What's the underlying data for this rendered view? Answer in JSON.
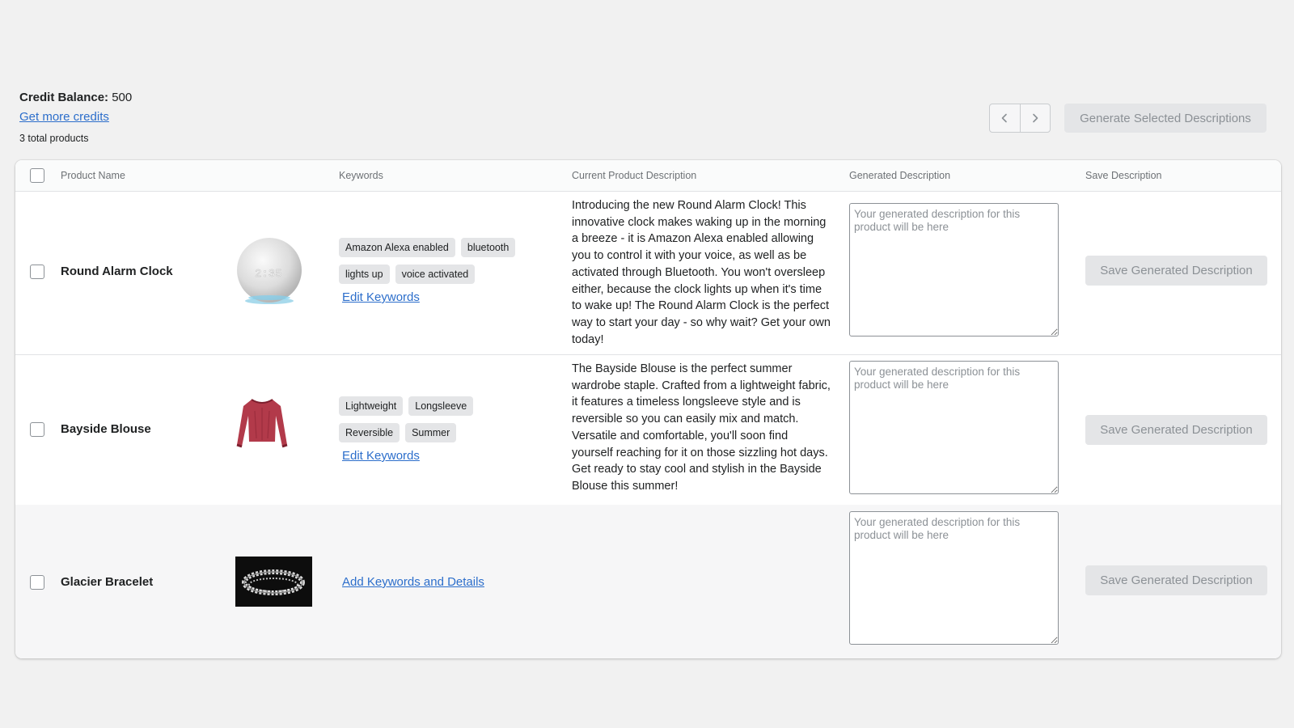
{
  "header": {
    "credit_label": "Credit Balance:",
    "credit_value": "500",
    "get_credits": "Get more credits",
    "total_products": "3 total products",
    "generate_selected": "Generate Selected Descriptions"
  },
  "table": {
    "columns": {
      "product_name": "Product Name",
      "keywords": "Keywords",
      "current_description": "Current Product Description",
      "generated_description": "Generated Description",
      "save_description": "Save Description"
    },
    "placeholder": "Your generated description for this product will be here",
    "save_label": "Save Generated Description",
    "edit_keywords": "Edit Keywords",
    "add_keywords": "Add Keywords and Details",
    "rows": [
      {
        "name": "Round Alarm Clock",
        "image": "smart-clock-image",
        "keywords": [
          "Amazon Alexa enabled",
          "bluetooth",
          "lights up",
          "voice activated"
        ],
        "description": "Introducing the new Round Alarm Clock! This innovative clock makes waking up in the morning a breeze - it is Amazon Alexa enabled allowing you to control it with your voice, as well as be activated through Bluetooth. You won't oversleep either, because the clock lights up when it's time to wake up! The Round Alarm Clock is the perfect way to start your day - so why wait? Get your own today!",
        "clock_display": "2:35"
      },
      {
        "name": "Bayside Blouse",
        "image": "blouse-image",
        "keywords": [
          "Lightweight",
          "Longsleeve",
          "Reversible",
          "Summer"
        ],
        "description": "The Bayside Blouse is the perfect summer wardrobe staple. Crafted from a lightweight fabric, it features a timeless longsleeve style and is reversible so you can easily mix and match. Versatile and comfortable, you'll soon find yourself reaching for it on those sizzling hot days. Get ready to stay cool and stylish in the Bayside Blouse this summer!"
      },
      {
        "name": "Glacier Bracelet",
        "image": "bracelet-image",
        "keywords": [],
        "description": ""
      }
    ]
  },
  "icons": {
    "prev": "chevron-left-icon",
    "next": "chevron-right-icon"
  }
}
